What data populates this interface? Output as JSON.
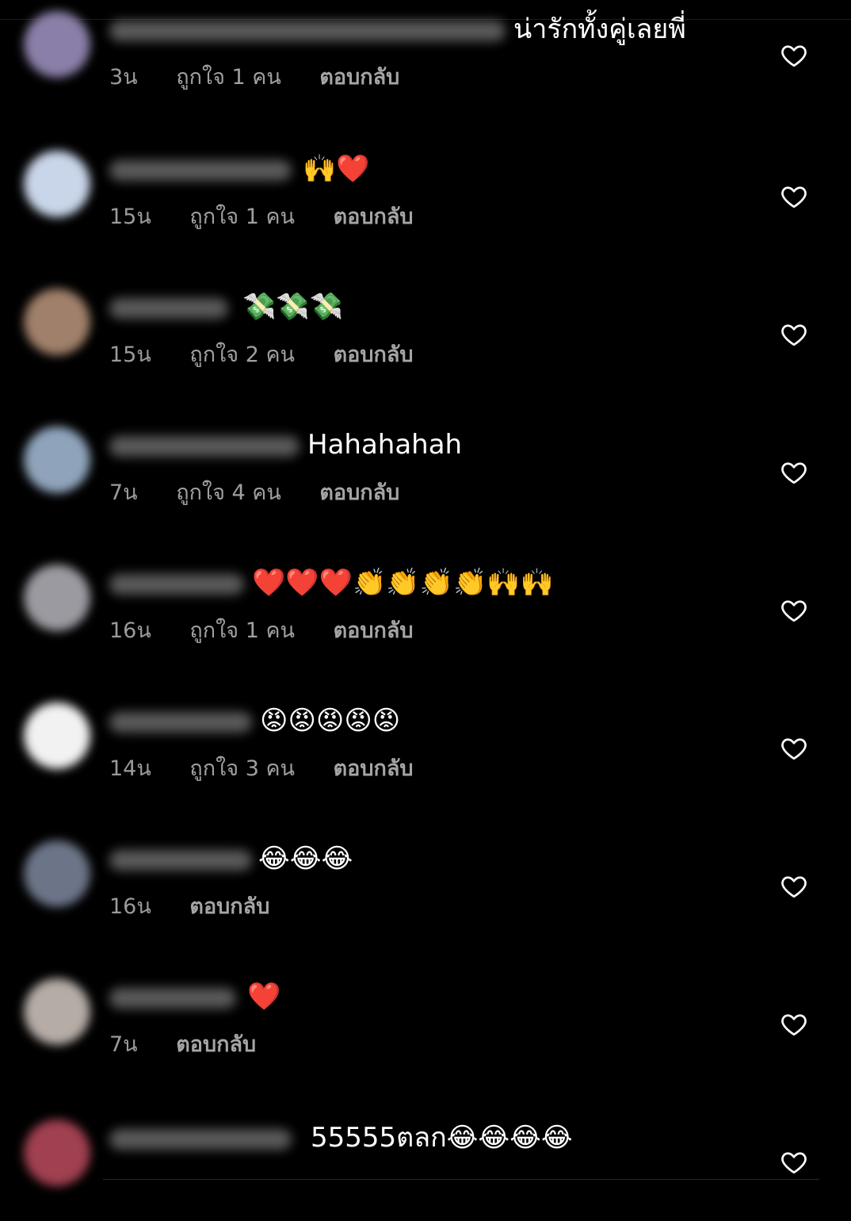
{
  "comments": [
    {
      "text": "น่ารักทั้งคู่เลยพี่",
      "time": "3น",
      "likes": "ถูกใจ 1 คน",
      "reply": "ตอบกลับ",
      "avatar_color": "#8a7fa8"
    },
    {
      "text": "🙌❤️",
      "time": "15น",
      "likes": "ถูกใจ 1 คน",
      "reply": "ตอบกลับ",
      "avatar_color": "#c9d6ea"
    },
    {
      "text": "💸💸💸",
      "time": "15น",
      "likes": "ถูกใจ 2 คน",
      "reply": "ตอบกลับ",
      "avatar_color": "#a0806a"
    },
    {
      "text": "Hahahahah",
      "time": "7น",
      "likes": "ถูกใจ 4 คน",
      "reply": "ตอบกลับ",
      "avatar_color": "#8fa4bb"
    },
    {
      "text": "❤️❤️❤️👏👏👏👏🙌🙌",
      "time": "16น",
      "likes": "ถูกใจ 1 คน",
      "reply": "ตอบกลับ",
      "avatar_color": "#9a9aa0"
    },
    {
      "text": "😡😡😡😡😡",
      "time": "14น",
      "likes": "ถูกใจ 3 คน",
      "reply": "ตอบกลับ",
      "avatar_color": "#f2f2f2"
    },
    {
      "text": "😂😂😂",
      "time": "16น",
      "likes": "",
      "reply": "ตอบกลับ",
      "avatar_color": "#6c7588"
    },
    {
      "text": "❤️",
      "time": "7น",
      "likes": "",
      "reply": "ตอบกลับ",
      "avatar_color": "#b5aca6"
    },
    {
      "text": "55555ตลก😂😂😂😂",
      "time": "",
      "likes": "",
      "reply": "",
      "avatar_color": "#a04050"
    }
  ],
  "icons": {
    "like": "heart-outline-icon"
  },
  "colors": {
    "background": "#000000",
    "text": "#ffffff",
    "meta": "#9a9a9a"
  }
}
